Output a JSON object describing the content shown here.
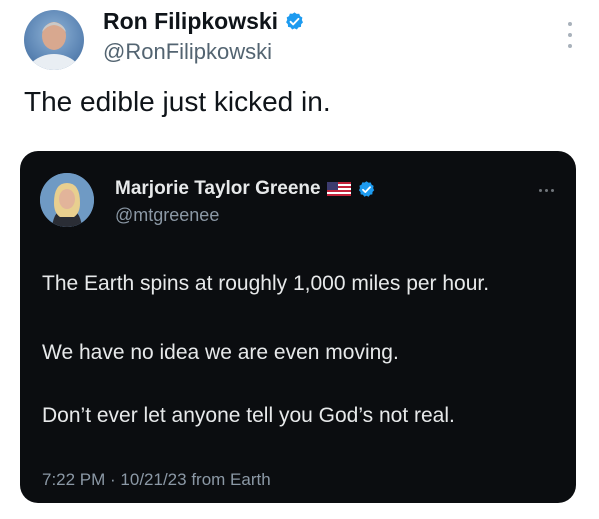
{
  "tweet": {
    "author_name": "Ron Filipkowski",
    "author_handle": "@RonFilipkowski",
    "text": "The edible just kicked in.",
    "more_icon": "more-vertical-icon",
    "verified_icon": "verified-badge-icon"
  },
  "quoted_tweet": {
    "author_name": "Marjorie Taylor Greene",
    "author_handle": "@mtgreenee",
    "flag_icon": "us-flag-icon",
    "verified_icon": "verified-badge-icon",
    "more_icon": "more-horizontal-icon",
    "lines": [
      "The Earth spins at roughly 1,000 miles per hour.",
      "We have no idea we are even moving.",
      "Don’t ever let anyone tell you God’s not real."
    ],
    "meta": "7:22 PM · 10/21/23 from Earth"
  },
  "colors": {
    "verified_blue": "#1d9bf0",
    "card_background": "#0b0d10",
    "primary_text": "#0f1419",
    "secondary_text": "#536471"
  }
}
